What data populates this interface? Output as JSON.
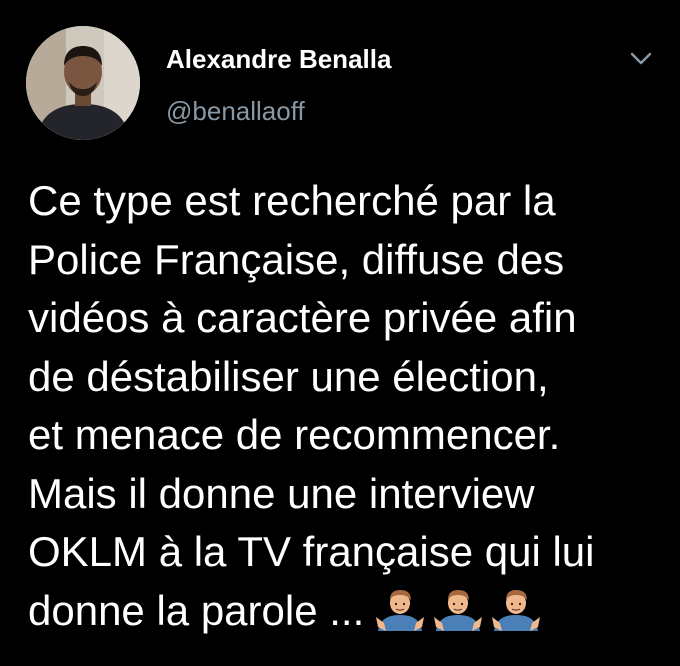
{
  "author": {
    "display_name": "Alexandre Benalla",
    "handle": "@benallaoff"
  },
  "tweet": {
    "lines": [
      "Ce type est recherché par la",
      "Police Française, diffuse des",
      "vidéos à caractère privée afin",
      "de déstabiliser une élection,",
      "et menace de recommencer.",
      "Mais il donne une interview",
      "OKLM à la TV française qui lui",
      "donne la parole ..."
    ],
    "emojis": [
      "person-shrugging-emoji",
      "person-shrugging-emoji",
      "person-shrugging-emoji"
    ]
  },
  "icons": {
    "caret": "chevron-down-icon"
  },
  "colors": {
    "background": "#000000",
    "text": "#ffffff",
    "secondary": "#8899a6"
  }
}
